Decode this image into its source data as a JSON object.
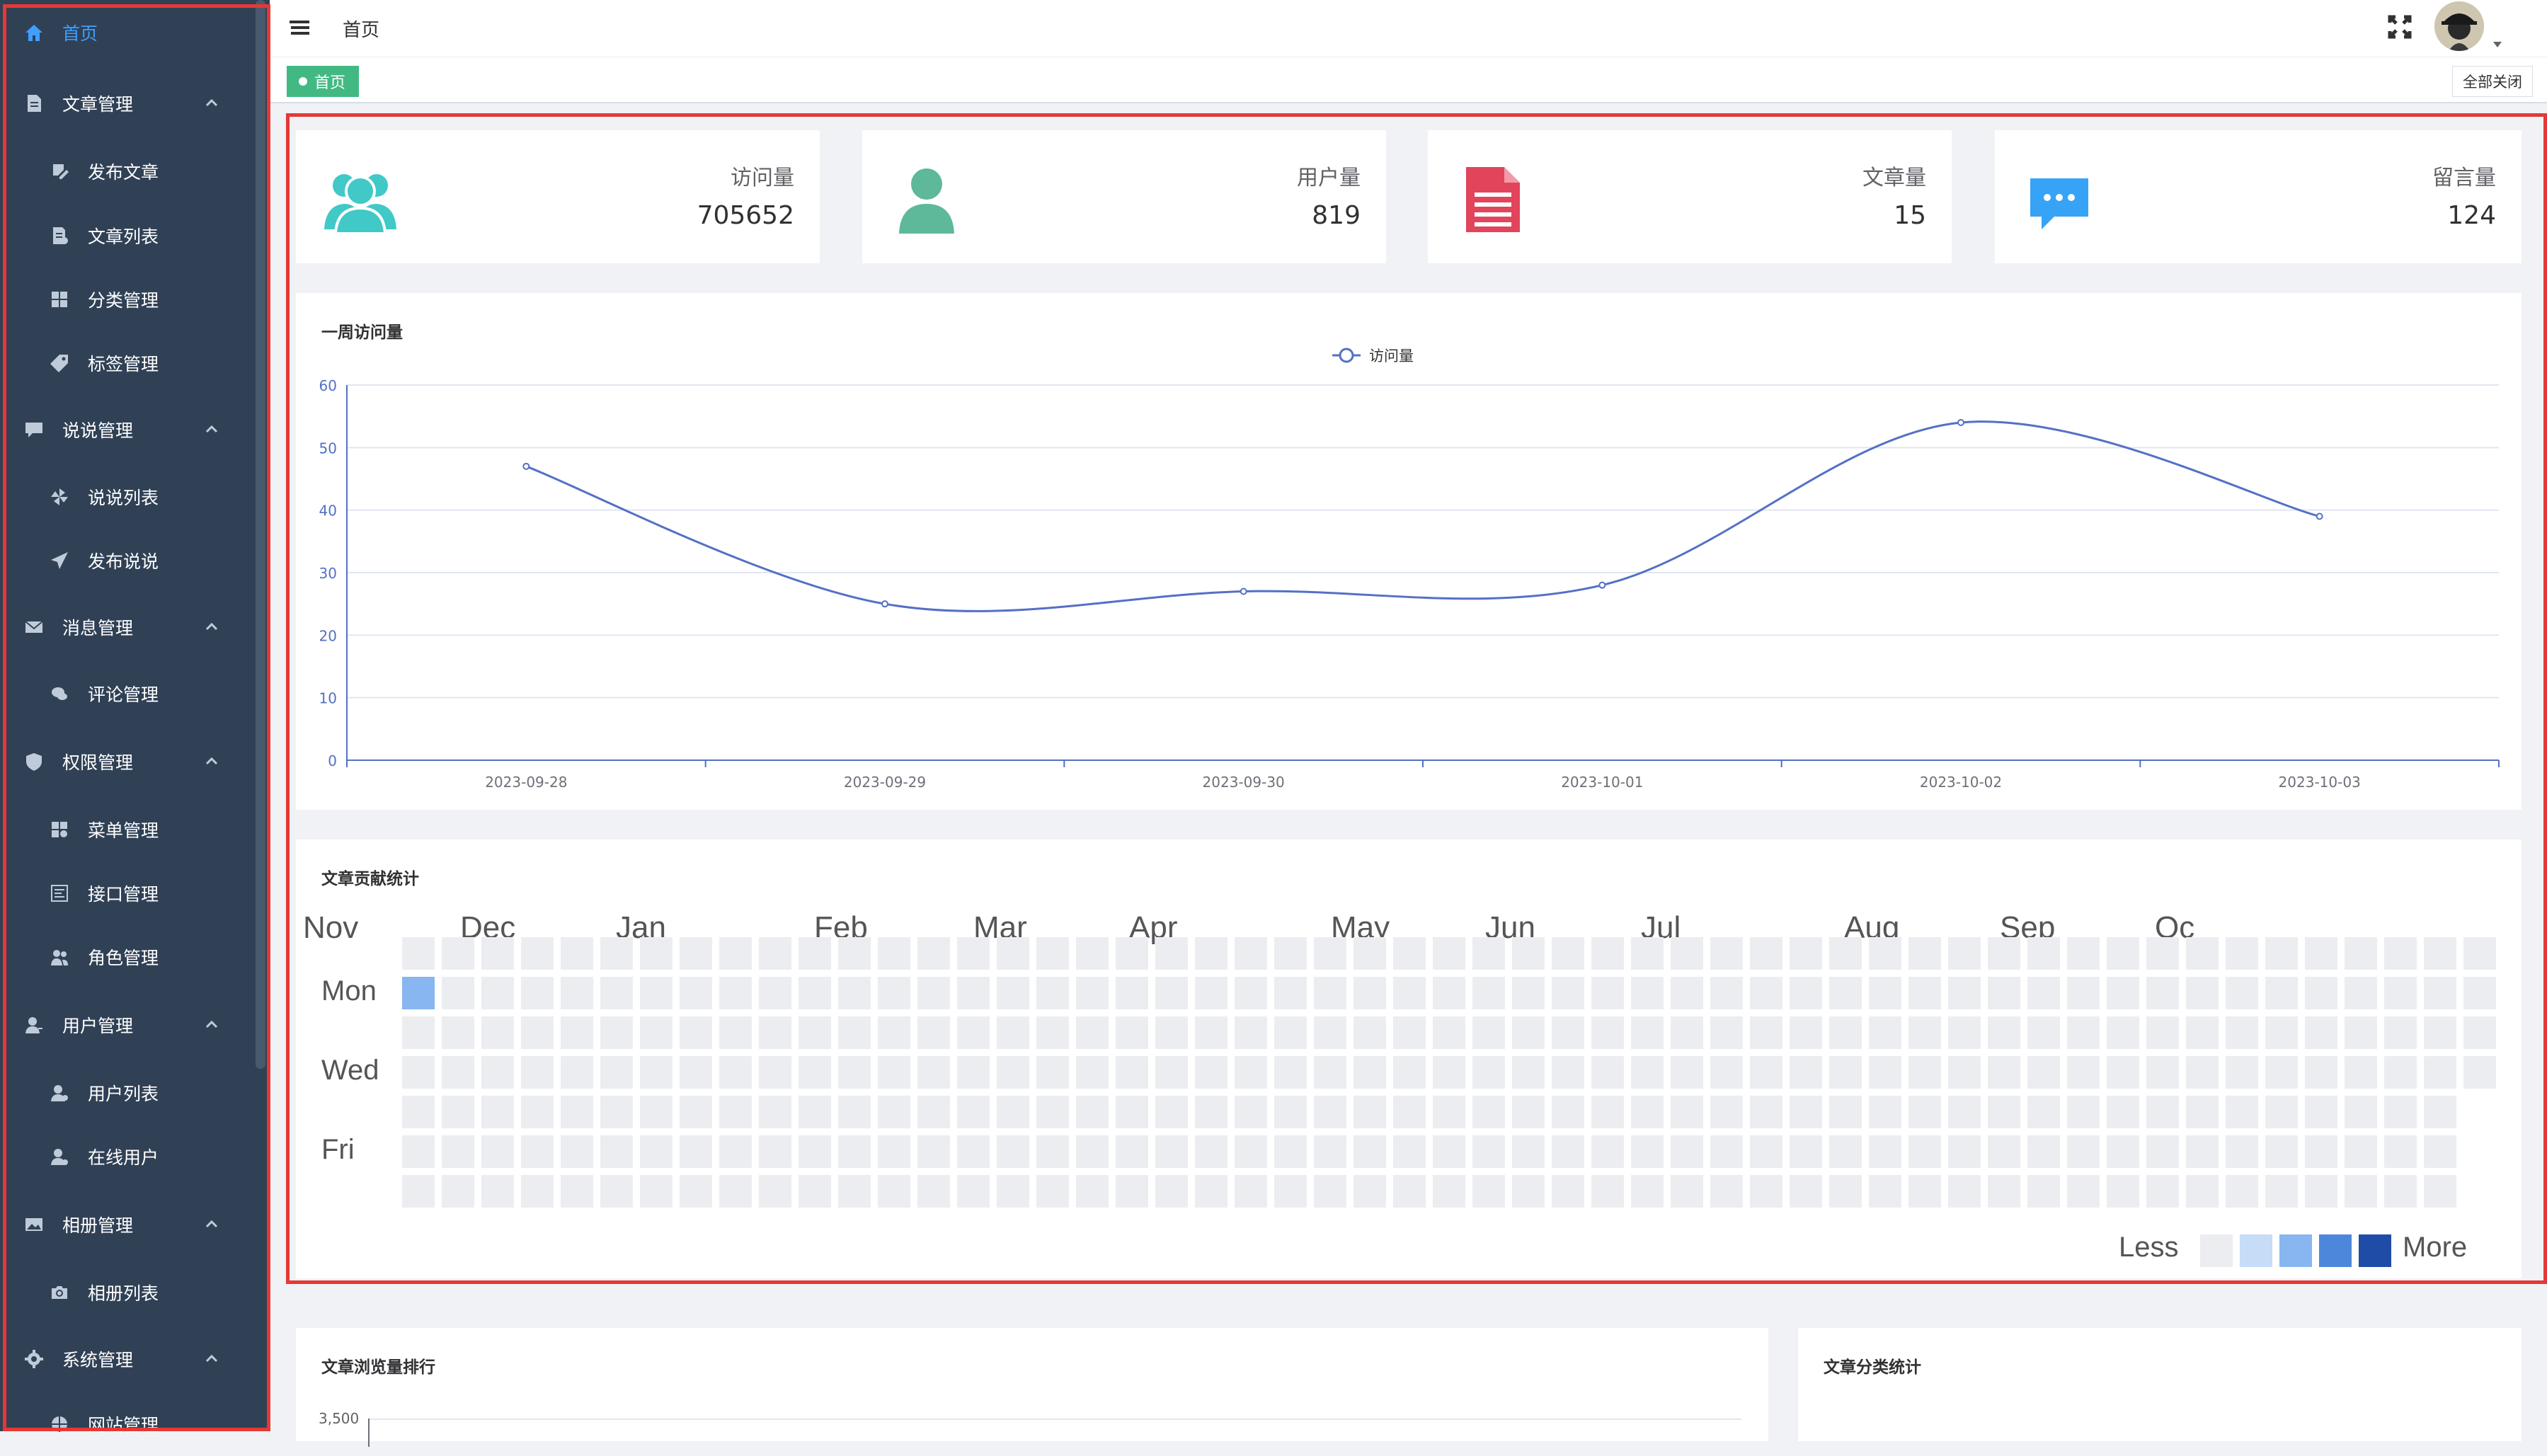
{
  "sidebar": {
    "items": [
      {
        "label": "首页",
        "icon": "home-icon",
        "level": "top",
        "active": true
      },
      {
        "label": "文章管理",
        "icon": "document-icon",
        "level": "top",
        "expandable": true
      },
      {
        "label": "发布文章",
        "icon": "edit-icon",
        "level": "sub"
      },
      {
        "label": "文章列表",
        "icon": "list-icon",
        "level": "sub"
      },
      {
        "label": "分类管理",
        "icon": "category-icon",
        "level": "sub"
      },
      {
        "label": "标签管理",
        "icon": "tag-icon",
        "level": "sub"
      },
      {
        "label": "说说管理",
        "icon": "chat-icon",
        "level": "top",
        "expandable": true
      },
      {
        "label": "说说列表",
        "icon": "pinwheel-icon",
        "level": "sub"
      },
      {
        "label": "发布说说",
        "icon": "send-icon",
        "level": "sub"
      },
      {
        "label": "消息管理",
        "icon": "mail-icon",
        "level": "top",
        "expandable": true
      },
      {
        "label": "评论管理",
        "icon": "comment-icon",
        "level": "sub"
      },
      {
        "label": "权限管理",
        "icon": "shield-icon",
        "level": "top",
        "expandable": true
      },
      {
        "label": "菜单管理",
        "icon": "menu-icon",
        "level": "sub"
      },
      {
        "label": "接口管理",
        "icon": "api-icon",
        "level": "sub"
      },
      {
        "label": "角色管理",
        "icon": "role-icon",
        "level": "sub"
      },
      {
        "label": "用户管理",
        "icon": "user-icon",
        "level": "top",
        "expandable": true
      },
      {
        "label": "用户列表",
        "icon": "user-list-icon",
        "level": "sub"
      },
      {
        "label": "在线用户",
        "icon": "online-user-icon",
        "level": "sub"
      },
      {
        "label": "相册管理",
        "icon": "album-icon",
        "level": "top",
        "expandable": true
      },
      {
        "label": "相册列表",
        "icon": "camera-icon",
        "level": "sub"
      },
      {
        "label": "系统管理",
        "icon": "settings-icon",
        "level": "top",
        "expandable": true
      },
      {
        "label": "网站管理",
        "icon": "globe-icon",
        "level": "sub"
      }
    ]
  },
  "navbar": {
    "breadcrumb": "首页",
    "hamburger_icon": "hamburger-icon",
    "fullscreen_icon": "fullscreen-icon"
  },
  "tags": {
    "home": "首页",
    "close_all": "全部关闭"
  },
  "stats": [
    {
      "label": "访问量",
      "value": "705652",
      "icon": "users-icon",
      "color": "#40c9c6"
    },
    {
      "label": "用户量",
      "value": "819",
      "icon": "user-icon",
      "color": "#5eb89a"
    },
    {
      "label": "文章量",
      "value": "15",
      "icon": "article-icon",
      "color": "#e2445c"
    },
    {
      "label": "留言量",
      "value": "124",
      "icon": "message-icon",
      "color": "#36a3f7"
    }
  ],
  "weekly": {
    "title": "一周访问量",
    "chart_data": {
      "type": "line",
      "x": [
        "2023-09-28",
        "2023-09-29",
        "2023-09-30",
        "2023-10-01",
        "2023-10-02",
        "2023-10-03"
      ],
      "series": [
        {
          "name": "访问量",
          "values": [
            47,
            25,
            27,
            28,
            54,
            39
          ]
        }
      ],
      "ylim": [
        0,
        60
      ],
      "yticks": [
        0,
        10,
        20,
        30,
        40,
        50,
        60
      ],
      "legend": "top-center",
      "grid": true,
      "color": "#5470c6"
    }
  },
  "contrib": {
    "title": "文章贡献统计",
    "months": [
      "Nov",
      "Dec",
      "Jan",
      "Feb",
      "Mar",
      "Apr",
      "May",
      "Jun",
      "Jul",
      "Aug",
      "Sep",
      "Oc"
    ],
    "days": [
      "Mon",
      "Wed",
      "Fri"
    ],
    "legend_less": "Less",
    "legend_more": "More",
    "colors": [
      "#ebedf0",
      "#c6dcf7",
      "#87b6f0",
      "#4d87db",
      "#1f4ca6"
    ],
    "weeks": 53,
    "active_cells": [
      {
        "week": 0,
        "day": 1,
        "level": 2
      }
    ]
  },
  "bottom": {
    "ranking_title": "文章浏览量排行",
    "ranking_first_tick": "3,500",
    "category_title": "文章分类统计"
  }
}
